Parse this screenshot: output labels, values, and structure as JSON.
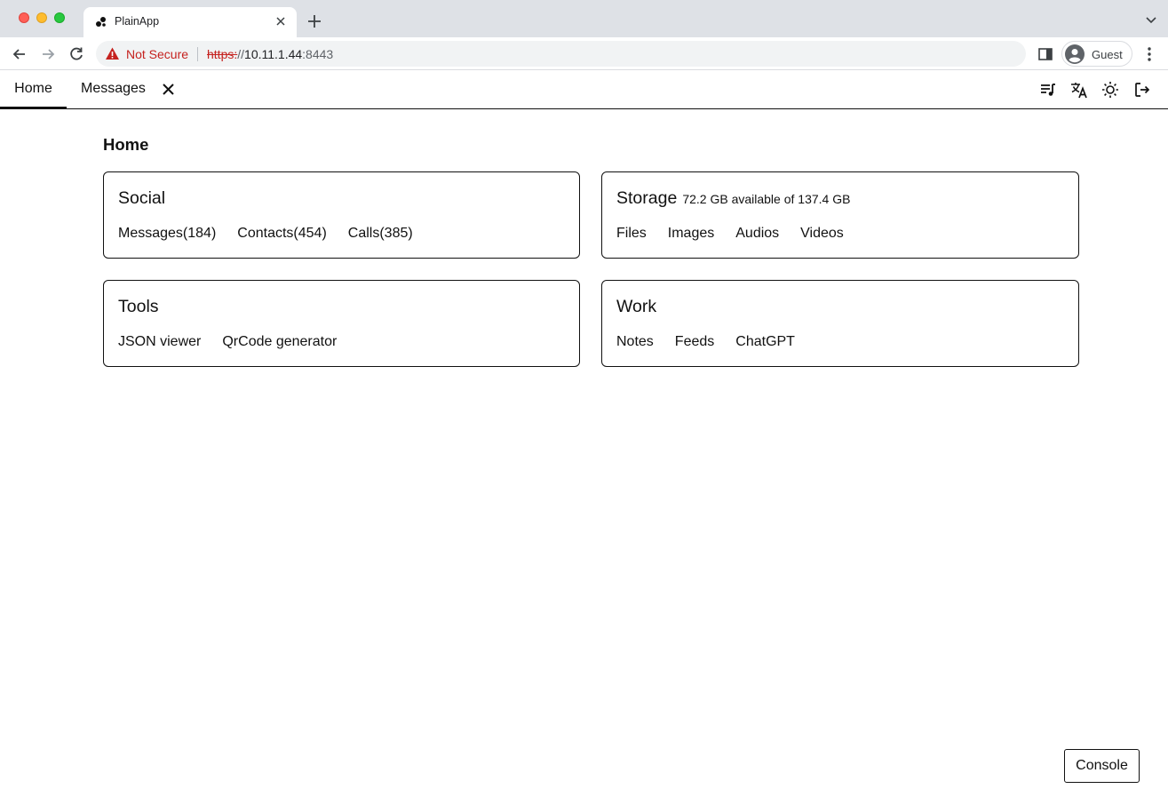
{
  "browser": {
    "tab_title": "PlainApp",
    "omnibox": {
      "security_label": "Not Secure",
      "url_scheme": "https:",
      "url_slashes": "//",
      "url_host": "10.11.1.44",
      "url_port": ":8443"
    },
    "profile_name": "Guest"
  },
  "app": {
    "tabs": [
      {
        "label": "Home",
        "active": true
      },
      {
        "label": "Messages",
        "active": false
      }
    ],
    "header_icons": [
      "playlist-music-icon",
      "translate-icon",
      "theme-sun-icon",
      "logout-icon"
    ],
    "page_title": "Home",
    "cards": {
      "social": {
        "title": "Social",
        "links": [
          "Messages(184)",
          "Contacts(454)",
          "Calls(385)"
        ]
      },
      "storage": {
        "title": "Storage",
        "subtitle": "72.2 GB available of 137.4 GB",
        "links": [
          "Files",
          "Images",
          "Audios",
          "Videos"
        ]
      },
      "tools": {
        "title": "Tools",
        "links": [
          "JSON viewer",
          "QrCode generator"
        ]
      },
      "work": {
        "title": "Work",
        "links": [
          "Notes",
          "Feeds",
          "ChatGPT"
        ]
      }
    },
    "console_label": "Console"
  },
  "colors": {
    "tabstrip_bg": "#dee1e6",
    "omnibox_bg": "#f1f3f4",
    "warning_red": "#c5221f",
    "text": "#111111"
  }
}
